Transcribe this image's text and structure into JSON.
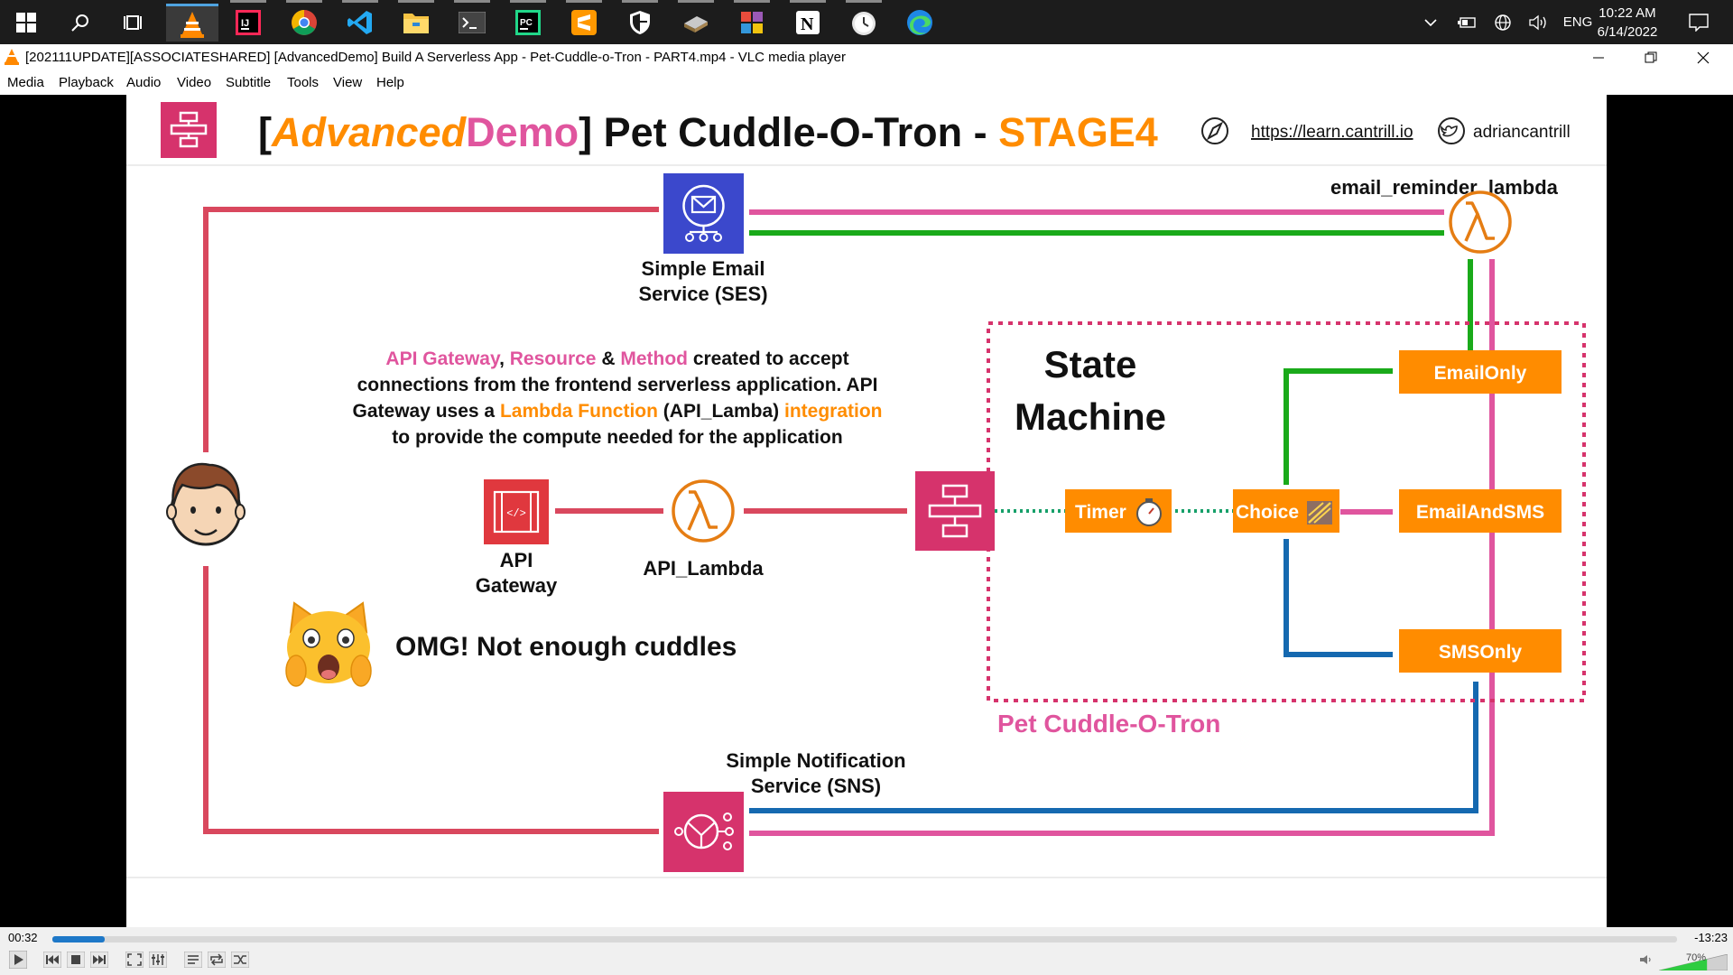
{
  "taskbar": {
    "clock_time": "10:22 AM",
    "clock_date": "6/14/2022",
    "language": "ENG"
  },
  "window": {
    "title": "[202111UPDATE][ASSOCIATESHARED] [AdvancedDemo] Build A Serverless App - Pet-Cuddle-o-Tron - PART4.mp4 - VLC media player"
  },
  "menu": [
    "Media",
    "Playback",
    "Audio",
    "Video",
    "Subtitle",
    "Tools",
    "View",
    "Help"
  ],
  "slide": {
    "title_bracket_open": "[",
    "title_advanced": "Advanced",
    "title_demo": "Demo",
    "title_bracket_close": "]",
    "title_main": " Pet Cuddle-O-Tron - ",
    "title_stage": "STAGE4",
    "link_url": "https://learn.cantrill.io",
    "twitter_handle": "adriancantrill",
    "ses_line1": "Simple Email",
    "ses_line2": "Service (SES)",
    "email_lambda_label": "email_reminder_lambda",
    "desc": {
      "p1": "API Gateway",
      "p2": ", ",
      "p3": "Resource",
      "p4": " & ",
      "p5": "Method",
      "p6": " created to accept",
      "line2": "connections from the frontend serverless application. API",
      "p7": "Gateway uses a ",
      "p8": "Lambda Function",
      "p9": " (API_Lamba) ",
      "p10": "integration",
      "line4": "to provide the compute needed for the application"
    },
    "api_gw_line1": "API",
    "api_gw_line2": "Gateway",
    "api_lambda_label": "API_Lambda",
    "state_machine_line1": "State",
    "state_machine_line2": "Machine",
    "timer_label": "Timer",
    "choice_label": "Choice",
    "email_only": "EmailOnly",
    "email_and_sms": "EmailAndSMS",
    "sms_only": "SMSOnly",
    "pet_cuddle_label": "Pet Cuddle-O-Tron",
    "omg_text": "OMG! Not enough cuddles",
    "sns_line1": "Simple Notification",
    "sns_line2": "Service (SNS)"
  },
  "player": {
    "elapsed": "00:32",
    "remaining": "-13:23",
    "progress_fraction": 0.032,
    "volume": "70%",
    "volume_fraction": 0.7
  },
  "colors": {
    "aws_pink": "#d6336c",
    "aws_orange": "#ff8c00",
    "ses_blue": "#3b48cc",
    "line_red": "#d9485e",
    "line_pink": "#e0559e",
    "line_green": "#1aaa1a",
    "line_blue": "#1569b0",
    "seek_blue": "#1e78c8"
  }
}
